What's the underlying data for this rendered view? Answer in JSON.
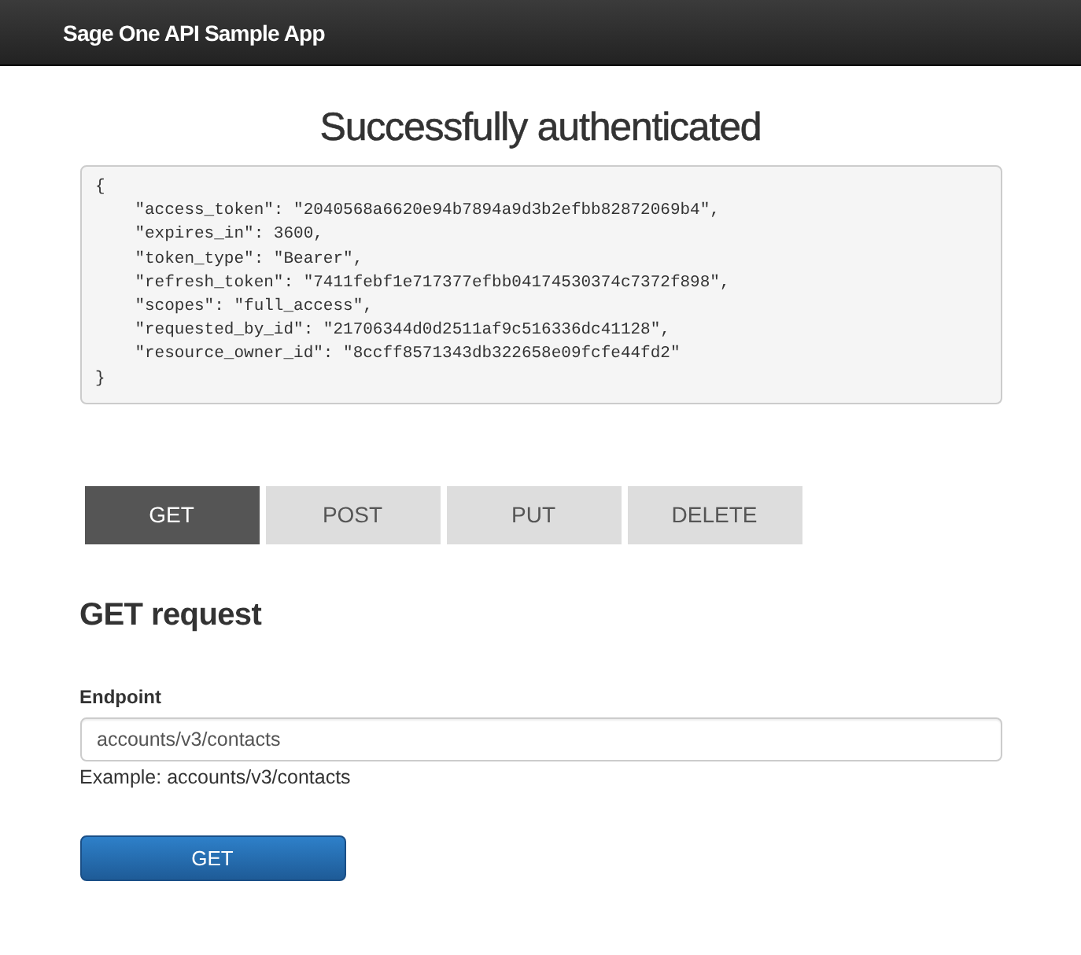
{
  "navbar": {
    "brand": "Sage One API Sample App"
  },
  "heading": "Successfully authenticated",
  "token_response": "{\n    \"access_token\": \"2040568a6620e94b7894a9d3b2efbb82872069b4\",\n    \"expires_in\": 3600,\n    \"token_type\": \"Bearer\",\n    \"refresh_token\": \"7411febf1e717377efbb04174530374c7372f898\",\n    \"scopes\": \"full_access\",\n    \"requested_by_id\": \"21706344d0d2511af9c516336dc41128\",\n    \"resource_owner_id\": \"8ccff8571343db322658e09fcfe44fd2\"\n}",
  "method_tabs": [
    {
      "label": "GET",
      "selected": true
    },
    {
      "label": "POST",
      "selected": false
    },
    {
      "label": "PUT",
      "selected": false
    },
    {
      "label": "DELETE",
      "selected": false
    }
  ],
  "request_heading": "GET request",
  "endpoint": {
    "label": "Endpoint",
    "value": "accounts/v3/contacts",
    "help": "Example: accounts/v3/contacts"
  },
  "submit_button": "GET"
}
